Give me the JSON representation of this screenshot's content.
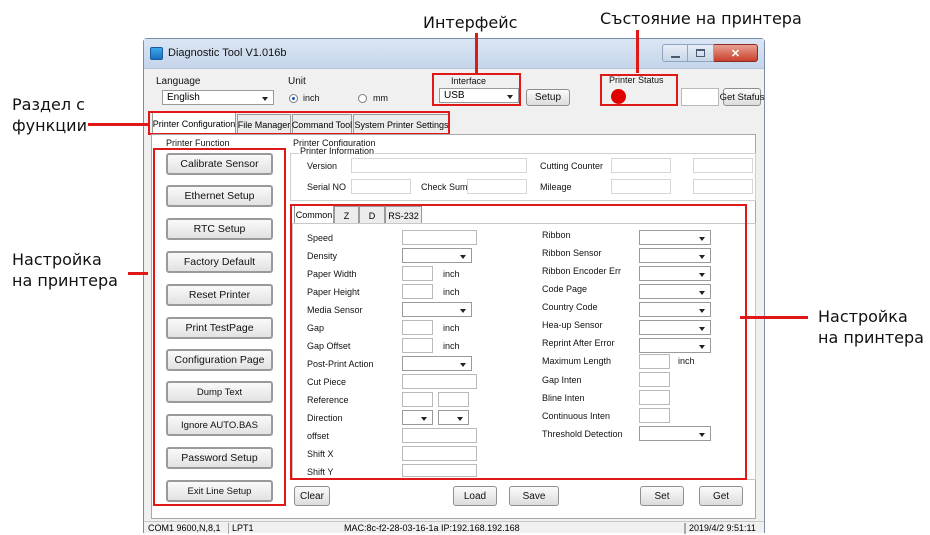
{
  "callouts": {
    "interface": "Интерфейс",
    "printer_status": "Състояние на принтера",
    "functions_line1": "Раздел с",
    "functions_line2": "функции",
    "settings_left_line1": "Настройка",
    "settings_left_line2": "на принтера",
    "settings_right_line1": "Настройка",
    "settings_right_line2": "на принтера"
  },
  "colors": {
    "accent_red": "#e01818",
    "status_led": "#e00000",
    "title_bg": "#c8d8ec",
    "window_bg": "#f0f0f0"
  },
  "window": {
    "title": "Diagnostic Tool V1.016b",
    "title_icon": "app-icon",
    "window_controls": [
      "minimize",
      "maximize",
      "close"
    ]
  },
  "top": {
    "language_label": "Language",
    "language_value": "English",
    "unit_label": "Unit",
    "unit_options": [
      "inch",
      "mm"
    ],
    "unit_selected": "inch",
    "interface_label": "Interface",
    "interface_value": "USB",
    "setup_button": "Setup",
    "printer_status_label": "Printer  Status",
    "get_status_button": "Get Stafus"
  },
  "tabs": [
    "Printer Configuration",
    "File Manager",
    "Command Tool",
    "System Printer Settings"
  ],
  "printer_function": {
    "label": "Printer  Function",
    "buttons": [
      "Calibrate Sensor",
      "Ethernet Setup",
      "RTC Setup",
      "Factory Default",
      "Reset Printer",
      "Print TestPage",
      "Configuration Page",
      "Dump Text",
      "Ignore AUTO.BAS",
      "Password Setup",
      "Exit Line Setup"
    ]
  },
  "config": {
    "label": "Printer Configuration",
    "info_label": "Printer Information",
    "version": "Version",
    "serial": "Serial NO",
    "checksum": "Check Sum",
    "cutting": "Cutting Counter",
    "mileage": "Mileage"
  },
  "subtabs": [
    "Common",
    "Z",
    "D",
    "RS-232"
  ],
  "left_fields": [
    "Speed",
    "Density",
    "Paper Width",
    "Paper Height",
    "Media Sensor",
    "Gap",
    "Gap Offset",
    "Post-Print  Action",
    "Cut  Piece",
    "Reference",
    "Direction",
    "offset",
    "Shift X",
    "Shift Y"
  ],
  "unit_inch": "inch",
  "right_fields": [
    "Ribbon",
    "Ribbon  Sensor",
    "Ribbon Encoder Err",
    "Code Page",
    "Country Code",
    "Hea-up  Sensor",
    "Reprint After  Error",
    "Maximum Length",
    "Gap Inten",
    "Bline  Inten",
    "Continuous  Inten",
    "Threshold  Detection"
  ],
  "bottom_buttons": {
    "clear": "Clear",
    "load": "Load",
    "save": "Save",
    "set": "Set",
    "get": "Get"
  },
  "statusbar": {
    "port": "COM1 9600,N,8,1",
    "lpt": "LPT1",
    "network": "MAC:8c-f2-28-03-16-1a   IP:192.168.192.168",
    "datetime": "2019/4/2 9:51:11"
  }
}
